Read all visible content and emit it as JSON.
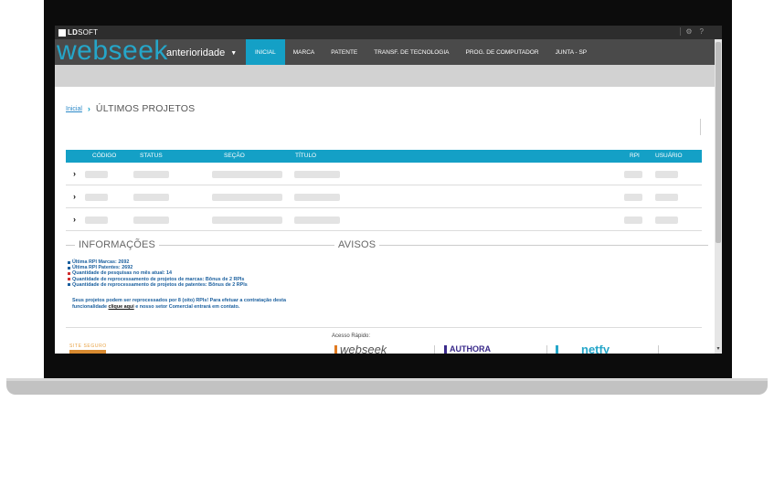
{
  "brand": {
    "mark": "LD",
    "name": "SOFT"
  },
  "top_icons": {
    "settings": "⚙",
    "help": "?"
  },
  "logo": {
    "word": "webseek",
    "sub": "anterioridade",
    "caret": "▼"
  },
  "menu": [
    {
      "label": "INICIAL",
      "active": true
    },
    {
      "label": "MARCA",
      "active": false
    },
    {
      "label": "PATENTE",
      "active": false
    },
    {
      "label": "TRANSF. DE TECNOLOGIA",
      "active": false
    },
    {
      "label": "PROG. DE COMPUTADOR",
      "active": false
    },
    {
      "label": "JUNTA - SP",
      "active": false
    }
  ],
  "breadcrumb": {
    "home": "Inicial",
    "separator": "›",
    "title": "ÚLTIMOS PROJETOS"
  },
  "table": {
    "headers": {
      "codigo": "CÓDIGO",
      "status": "STATUS",
      "secao": "SEÇÃO",
      "titulo": "TÍTULO",
      "rpi": "RPI",
      "usuario": "USUÁRIO"
    },
    "rows": 3,
    "expand_icon": "›"
  },
  "informacoes": {
    "title": "INFORMAÇÕES",
    "items": [
      {
        "text": "Última RPI Marcas: 2692",
        "color": "blue"
      },
      {
        "text": "Última RPI Patentes: 2692",
        "color": "blue"
      },
      {
        "text": "Quantidade de pesquisas no mês atual: 14",
        "color": "red"
      },
      {
        "text": "Quantidade de reprocessamento de projetos de marcas: Bônus de 2 RPIs",
        "color": "red"
      },
      {
        "text": "Quantidade de reprocessamento de projetos de patentes: Bônus de 2 RPIs",
        "color": "blue"
      }
    ],
    "note_before": "Seus projetos podem ser reprocessados por 8 (oito) RPIs! Para efetuar a contratação desta funcionalidade ",
    "note_link": "clique aqui",
    "note_after": " e nosso setor Comercial entrará em contato."
  },
  "avisos": {
    "title": "AVISOS"
  },
  "footer": {
    "site_seguro": "SITE SEGURO",
    "quick_access": "Acesso Rápido:",
    "logos": [
      {
        "text": "webseek",
        "color": "#e07a20"
      },
      {
        "text": "AUTHORA",
        "color": "#3a2a8a"
      },
      {
        "text": "netfy",
        "color": "#25a6c9"
      }
    ]
  },
  "colors": {
    "accent": "#14a0c6",
    "logo": "#25a6c9",
    "nav": "#4a4a4a",
    "info_text": "#1a5f9e",
    "bullet_red": "#d03030"
  }
}
